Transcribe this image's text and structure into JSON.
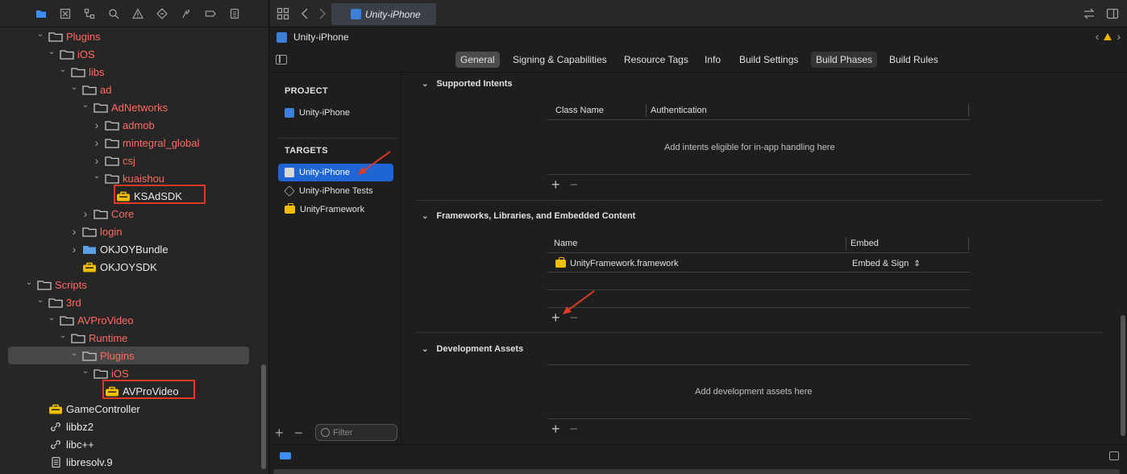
{
  "navigator": {
    "tree": [
      {
        "label": "Plugins",
        "depth": 3,
        "expanded": true,
        "color": "red",
        "kind": "folder"
      },
      {
        "label": "iOS",
        "depth": 4,
        "expanded": true,
        "color": "red",
        "kind": "folder"
      },
      {
        "label": "libs",
        "depth": 5,
        "expanded": true,
        "color": "red",
        "kind": "folder"
      },
      {
        "label": "ad",
        "depth": 6,
        "expanded": true,
        "color": "red",
        "kind": "folder"
      },
      {
        "label": "AdNetworks",
        "depth": 7,
        "expanded": true,
        "color": "red",
        "kind": "folder"
      },
      {
        "label": "admob",
        "depth": 8,
        "expanded": false,
        "color": "red",
        "kind": "folder"
      },
      {
        "label": "mintegral_global",
        "depth": 8,
        "expanded": false,
        "color": "red",
        "kind": "folder"
      },
      {
        "label": "csj",
        "depth": 8,
        "expanded": false,
        "color": "red",
        "kind": "folder"
      },
      {
        "label": "kuaishou",
        "depth": 8,
        "expanded": true,
        "color": "red",
        "kind": "folder"
      },
      {
        "label": "KSAdSDK",
        "depth": 9,
        "expanded": null,
        "color": "white",
        "kind": "framework"
      },
      {
        "label": "Core",
        "depth": 7,
        "expanded": false,
        "color": "red",
        "kind": "folder"
      },
      {
        "label": "login",
        "depth": 6,
        "expanded": false,
        "color": "red",
        "kind": "folder"
      },
      {
        "label": "OKJOYBundle",
        "depth": 6,
        "expanded": false,
        "color": "white",
        "kind": "bundle"
      },
      {
        "label": "OKJOYSDK",
        "depth": 6,
        "expanded": null,
        "color": "white",
        "kind": "framework"
      },
      {
        "label": "Scripts",
        "depth": 2,
        "expanded": true,
        "color": "red",
        "kind": "folder"
      },
      {
        "label": "3rd",
        "depth": 3,
        "expanded": true,
        "color": "red",
        "kind": "folder"
      },
      {
        "label": "AVProVideo",
        "depth": 4,
        "expanded": true,
        "color": "red",
        "kind": "folder"
      },
      {
        "label": "Runtime",
        "depth": 5,
        "expanded": true,
        "color": "red",
        "kind": "folder"
      },
      {
        "label": "Plugins",
        "depth": 6,
        "expanded": true,
        "color": "red",
        "kind": "folder",
        "selected": true
      },
      {
        "label": "iOS",
        "depth": 7,
        "expanded": true,
        "color": "red",
        "kind": "folder"
      },
      {
        "label": "AVProVideo",
        "depth": 8,
        "expanded": null,
        "color": "white",
        "kind": "framework"
      },
      {
        "label": "GameController",
        "depth": 3,
        "expanded": null,
        "color": "white",
        "kind": "framework"
      },
      {
        "label": "libbz2",
        "depth": 3,
        "expanded": null,
        "color": "white",
        "kind": "link"
      },
      {
        "label": "libc++",
        "depth": 3,
        "expanded": null,
        "color": "white",
        "kind": "link"
      },
      {
        "label": "libresolv.9",
        "depth": 3,
        "expanded": null,
        "color": "white",
        "kind": "doc"
      }
    ]
  },
  "editor": {
    "tab_title": "Unity-iPhone",
    "breadcrumb": "Unity-iPhone",
    "tabs": [
      "General",
      "Signing & Capabilities",
      "Resource Tags",
      "Info",
      "Build Settings",
      "Build Phases",
      "Build Rules"
    ],
    "active_tab": "General",
    "project_header": "PROJECT",
    "project_item": "Unity-iPhone",
    "targets_header": "TARGETS",
    "targets": [
      "Unity-iPhone",
      "Unity-iPhone Tests",
      "UnityFramework"
    ],
    "filter_placeholder": "Filter"
  },
  "sections": {
    "intents": {
      "title": "Supported Intents",
      "col1": "Class Name",
      "col2": "Authentication",
      "hint": "Add intents eligible for in-app handling here"
    },
    "frameworks": {
      "title": "Frameworks, Libraries, and Embedded Content",
      "col1": "Name",
      "col2": "Embed",
      "row_name": "UnityFramework.framework",
      "row_embed": "Embed & Sign"
    },
    "assets": {
      "title": "Development Assets",
      "hint": "Add development assets here"
    }
  },
  "colors": {
    "accent": "#1f65d4",
    "folder_blue": "#5aa0e6",
    "red_label": "#ff6b62",
    "annotation": "#e23a28",
    "framework_yellow": "#f0c000"
  }
}
